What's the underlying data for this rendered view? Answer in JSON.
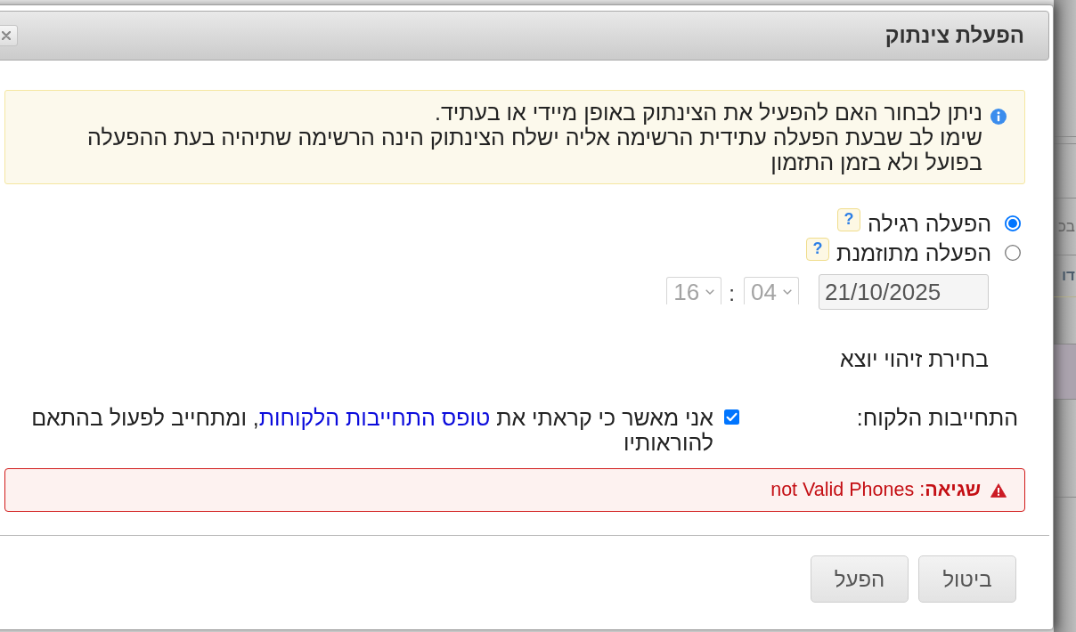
{
  "dialog": {
    "title": "הפעלת צינתוק",
    "info": {
      "lines": [
        "ניתן לבחור האם להפעיל את הצינתוק באופן מיידי או בעתיד.",
        "שימו לב שבעת הפעלה עתידית הרשימה אליה ישלח הצינתוק הינה הרשימה שתיהיה בעת ההפעלה בפועל ולא בזמן התזמון"
      ]
    },
    "activation_options": [
      {
        "label": "הפעלה רגילה",
        "selected": true,
        "help": "?"
      },
      {
        "label": "הפעלה מתוזמנת",
        "selected": false,
        "help": "?"
      }
    ],
    "schedule": {
      "date": "21/10/2025",
      "minute": "04",
      "separator": ":",
      "hour": "16",
      "disabled": true
    },
    "caller_id_label": "בחירת זיהוי יוצא",
    "commitment": {
      "label": "התחייבות הלקוח:",
      "checked": true,
      "text_before": "אני מאשר כי קראתי את",
      "link": "טופס התחייבות הלקוחות",
      "text_after": ", ומתחייב לפעול בהתאם להוראותיו"
    },
    "error": {
      "text": "**שגיאה**: not Valid Phones"
    },
    "buttons": [
      {
        "label": "ביטול"
      },
      {
        "label": "הפעל"
      }
    ]
  },
  "background_fragments": [
    "בכ",
    "דו"
  ]
}
